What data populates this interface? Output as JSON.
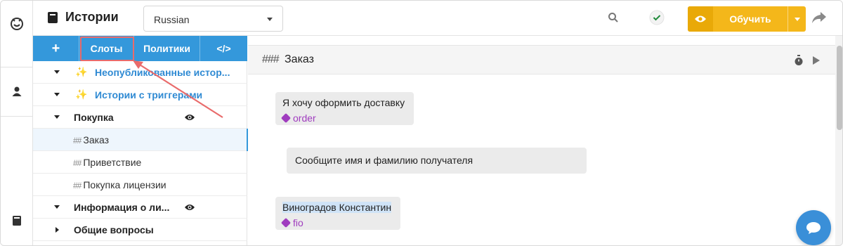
{
  "header": {
    "title": "Истории",
    "language": "Russian",
    "train_label": "Обучить"
  },
  "sidebar": {
    "toolbar": {
      "add": "+",
      "slots": "Слоты",
      "policies": "Политики",
      "code": "</>"
    },
    "tree": [
      {
        "label": "Неопубликованные истор...",
        "type": "folder",
        "expanded": true,
        "style": "magic"
      },
      {
        "label": "Истории с триггерами",
        "type": "folder",
        "expanded": true,
        "style": "magic"
      },
      {
        "label": "Покупка",
        "type": "folder",
        "expanded": true,
        "eye": true
      },
      {
        "label": "Заказ",
        "type": "story",
        "selected": true
      },
      {
        "label": "Приветствие",
        "type": "story"
      },
      {
        "label": "Покупка лицензии",
        "type": "story"
      },
      {
        "label": "Информация о ли...",
        "type": "folder",
        "expanded": true,
        "eye": true
      },
      {
        "label": "Общие вопросы",
        "type": "folder",
        "expanded": false
      }
    ]
  },
  "main": {
    "story_title": "Заказ",
    "messages": [
      {
        "role": "user",
        "text": "Я хочу оформить доставку",
        "intent": "order"
      },
      {
        "role": "bot",
        "text": "Сообщите имя и фамилию получателя"
      },
      {
        "role": "user",
        "text": "Виноградов Константин",
        "intent": "fio"
      }
    ]
  },
  "colors": {
    "accent": "#3498db",
    "train": "#f4b71a",
    "intent": "#a03cbf",
    "highlight": "#e96b6b"
  },
  "icons": [
    "bot-logo-icon",
    "user-icon",
    "book-icon",
    "search-icon",
    "check-circle-icon",
    "eye-icon",
    "share-arrow-icon",
    "timer-icon",
    "play-icon",
    "chat-icon",
    "tag-icon"
  ]
}
